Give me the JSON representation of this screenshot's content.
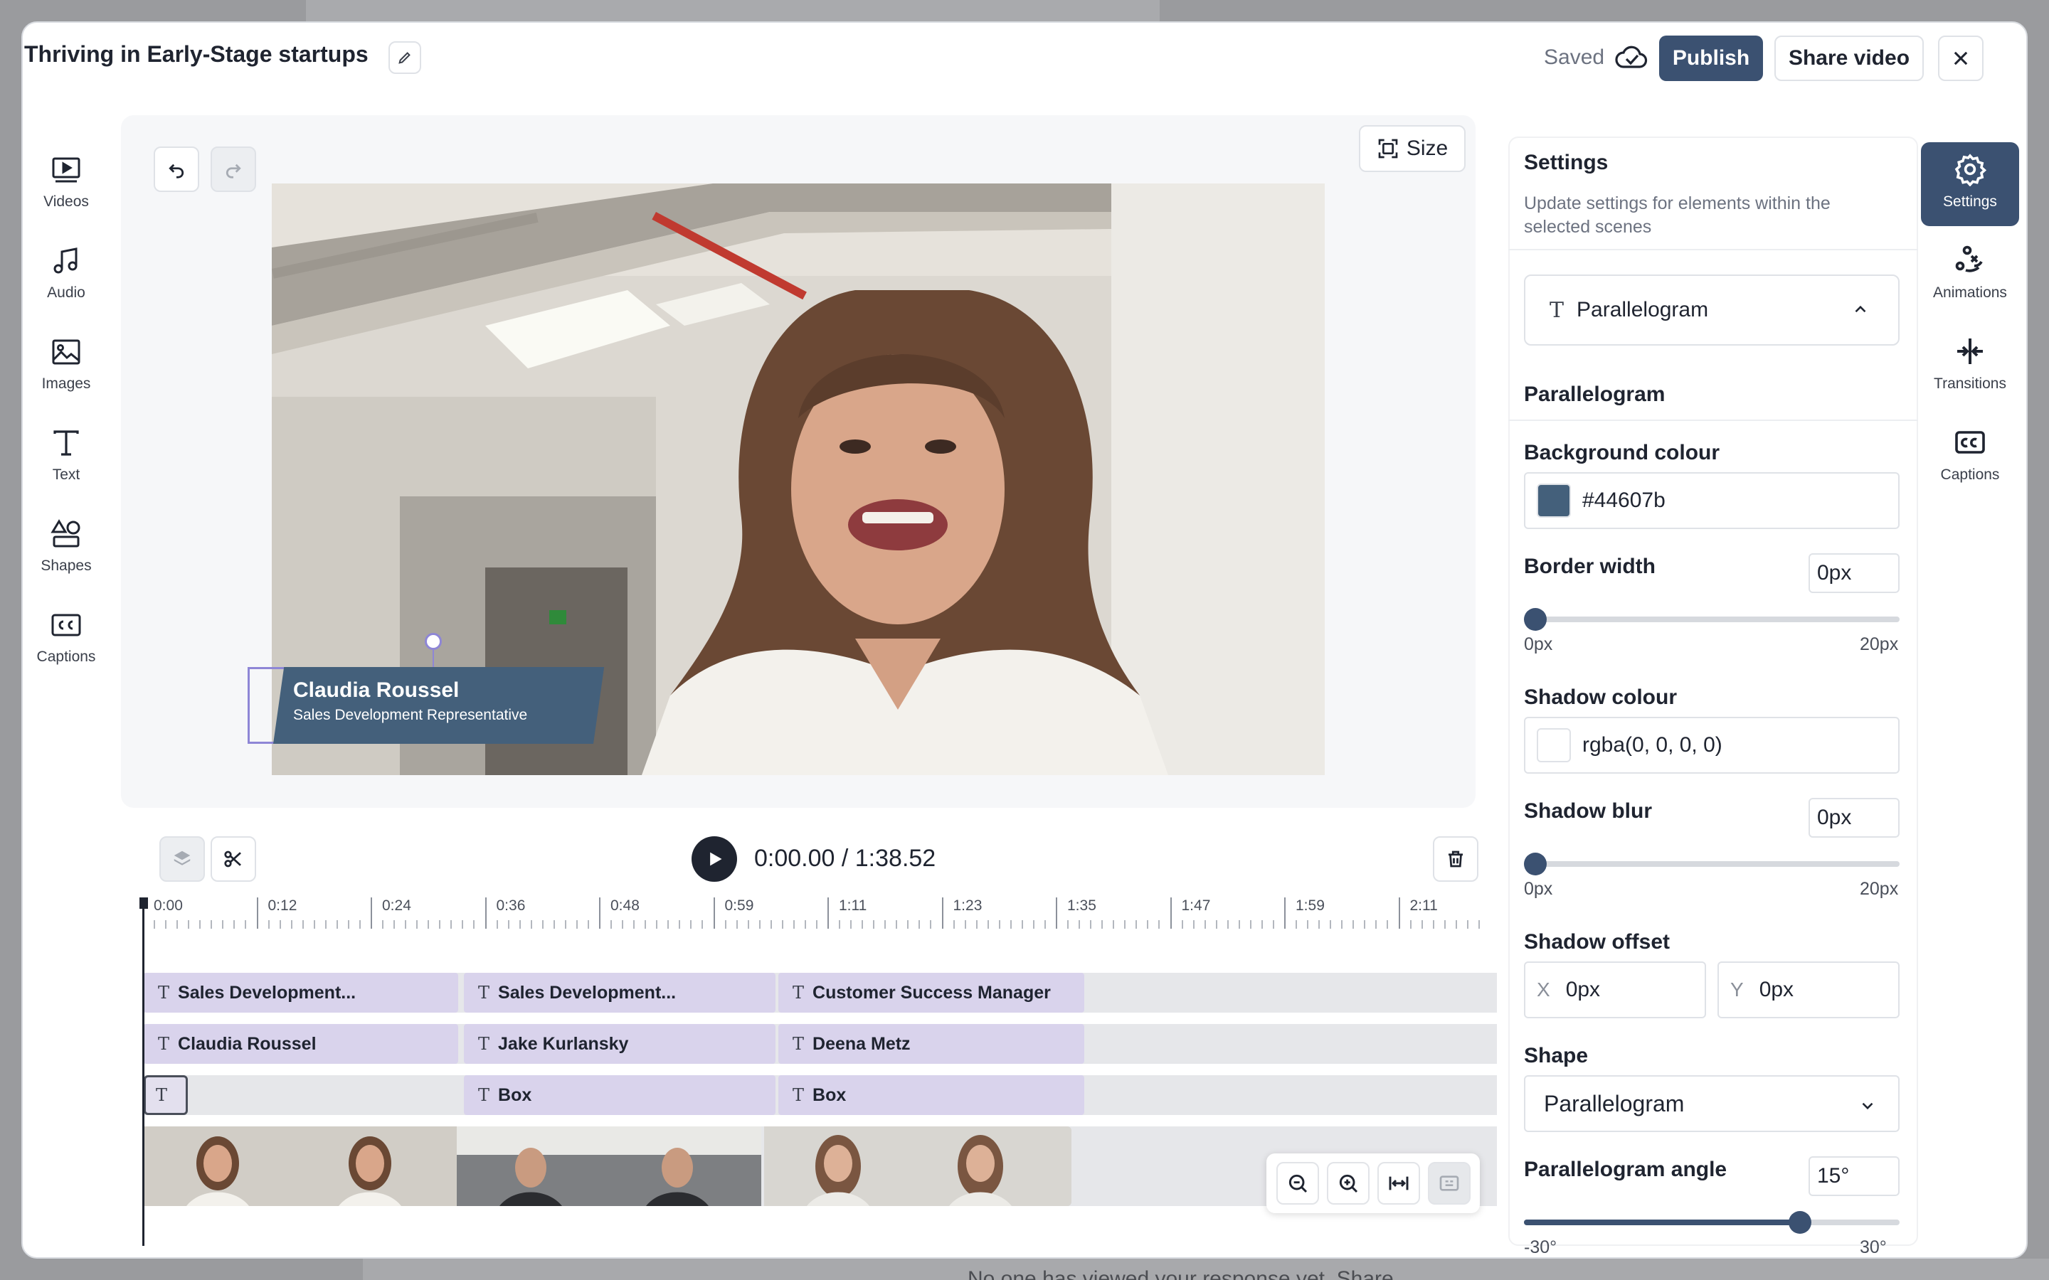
{
  "background": {
    "bottom_text": "No one has viewed your response yet. Share"
  },
  "header": {
    "title": "Thriving in Early-Stage startups",
    "saved_label": "Saved",
    "publish_label": "Publish",
    "share_label": "Share video"
  },
  "left_rail": {
    "items": [
      {
        "label": "Videos",
        "icon": "video-icon"
      },
      {
        "label": "Audio",
        "icon": "music-note-icon"
      },
      {
        "label": "Images",
        "icon": "image-icon"
      },
      {
        "label": "Text",
        "icon": "text-icon"
      },
      {
        "label": "Shapes",
        "icon": "shapes-icon"
      },
      {
        "label": "Captions",
        "icon": "captions-icon"
      }
    ]
  },
  "canvas": {
    "size_label": "Size",
    "lower_third": {
      "name": "Claudia Roussel",
      "role": "Sales Development Representative",
      "color": "#44607b"
    }
  },
  "timeline": {
    "timecode": "0:00.00 / 1:38.52",
    "ruler_labels": [
      "0:00",
      "0:12",
      "0:24",
      "0:36",
      "0:48",
      "0:59",
      "1:11",
      "1:23",
      "1:35",
      "1:47",
      "1:59",
      "2:11"
    ],
    "tracks": {
      "titles": [
        "Sales Development...",
        "Sales Development...",
        "Customer Success Manager"
      ],
      "names": [
        "Claudia Roussel",
        "Jake Kurlansky",
        "Deena Metz"
      ],
      "shapes": [
        "",
        "Box",
        "Box"
      ]
    }
  },
  "settings": {
    "title": "Settings",
    "subtitle": "Update settings for elements within the selected scenes",
    "accordion_label": "Parallelogram",
    "section_title": "Parallelogram",
    "background_colour": {
      "label": "Background colour",
      "value": "#44607b",
      "swatch": "#44607b"
    },
    "border_width": {
      "label": "Border width",
      "value": "0px",
      "min": "0px",
      "max": "20px",
      "level": 0
    },
    "shadow_colour": {
      "label": "Shadow colour",
      "value": "rgba(0, 0, 0, 0)",
      "swatch": "#ffffff"
    },
    "shadow_blur": {
      "label": "Shadow blur",
      "value": "0px",
      "min": "0px",
      "max": "20px",
      "level": 0
    },
    "shadow_offset": {
      "label": "Shadow offset",
      "x_axis": "X",
      "x_value": "0px",
      "y_axis": "Y",
      "y_value": "0px"
    },
    "shape": {
      "label": "Shape",
      "value": "Parallelogram"
    },
    "angle": {
      "label": "Parallelogram angle",
      "value": "15°",
      "min": "-30°",
      "max": "30°",
      "level": 0.75
    }
  },
  "right_rail": {
    "items": [
      {
        "label": "Settings",
        "icon": "gear-icon",
        "active": true
      },
      {
        "label": "Animations",
        "icon": "animations-icon",
        "active": false
      },
      {
        "label": "Transitions",
        "icon": "transitions-icon",
        "active": false
      },
      {
        "label": "Captions",
        "icon": "captions-icon",
        "active": false
      }
    ]
  }
}
